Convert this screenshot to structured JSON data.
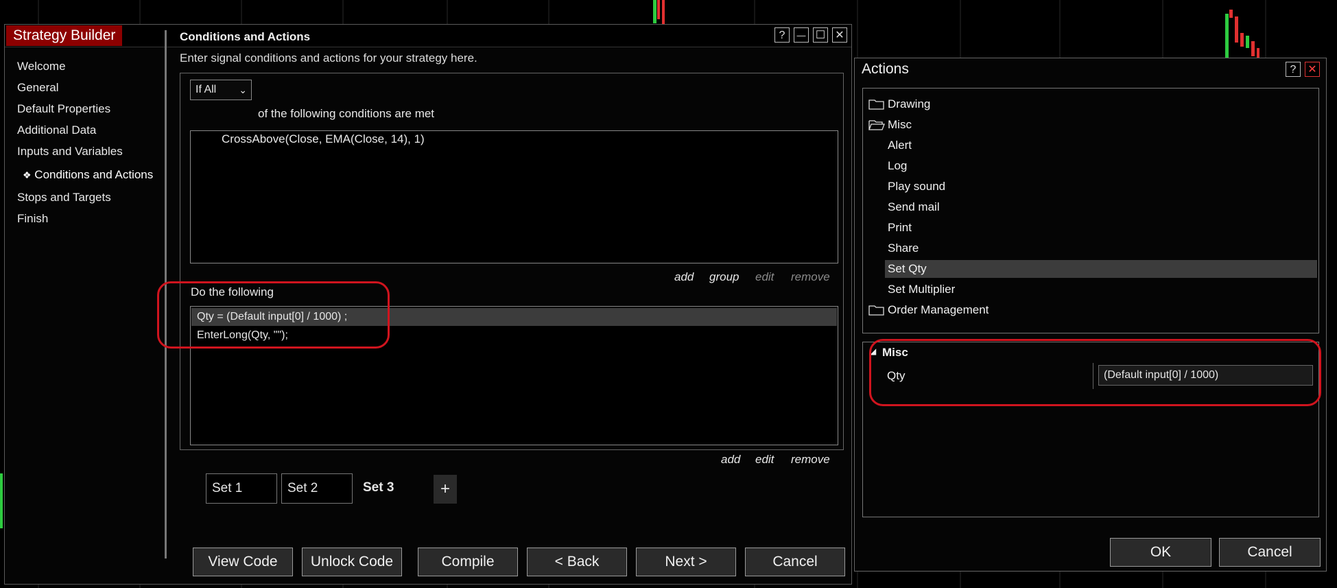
{
  "strategy_builder": {
    "title": "Strategy Builder",
    "nav": [
      "Welcome",
      "General",
      "Default Properties",
      "Additional Data",
      "Inputs and Variables",
      "Conditions and Actions",
      "Stops and Targets",
      "Finish"
    ],
    "nav_selected_marker": "❖",
    "section_title": "Conditions and Actions",
    "section_subtitle": "Enter signal conditions and actions for your strategy here.",
    "condition_mode": "If All",
    "condition_suffix": "of the following conditions are met",
    "conditions": [
      "CrossAbove(Close, EMA(Close, 14), 1)"
    ],
    "conditions_links": {
      "add": "add",
      "group": "group",
      "edit": "edit",
      "remove": "remove"
    },
    "actions_label": "Do the following",
    "actions": [
      "Qty = (Default input[0] / 1000) ;",
      "EnterLong(Qty, \"\");"
    ],
    "actions_links": {
      "add": "add",
      "edit": "edit",
      "remove": "remove"
    },
    "tabs": [
      "Set 1",
      "Set 2",
      "Set 3"
    ],
    "tab_add": "+",
    "buttons": {
      "view_code": "View Code",
      "unlock_code": "Unlock Code",
      "compile": "Compile",
      "back": "< Back",
      "next": "Next >",
      "cancel": "Cancel"
    },
    "title_buttons": {
      "help": "?",
      "minimize": "—",
      "maximize": "☐",
      "close": "✕"
    }
  },
  "actions_window": {
    "title": "Actions",
    "title_buttons": {
      "help": "?",
      "close": "✕"
    },
    "tree": {
      "drawing": "Drawing",
      "misc": "Misc",
      "misc_items": [
        "Alert",
        "Log",
        "Play sound",
        "Send mail",
        "Print",
        "Share",
        "Set Qty",
        "Set Multiplier"
      ],
      "order_management": "Order Management"
    },
    "props": {
      "category": "Misc",
      "field_label": "Qty",
      "field_value": "(Default input[0] / 1000)"
    },
    "buttons": {
      "ok": "OK",
      "cancel": "Cancel"
    }
  },
  "colors": {
    "title_red": "#8c0000",
    "highlight": "#d0141e",
    "selected_row": "#3c3c3c"
  }
}
